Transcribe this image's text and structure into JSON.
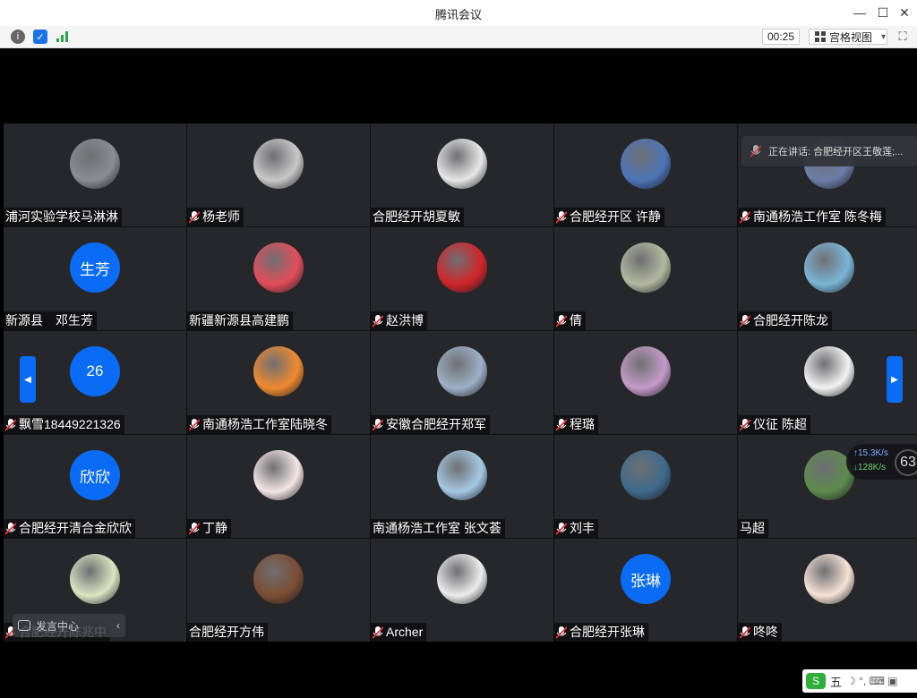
{
  "app": {
    "title": "腾讯会议"
  },
  "window_controls": {
    "minimize": "—",
    "maximize": "☐",
    "close": "✕"
  },
  "toolbar": {
    "timer": "00:25",
    "view_label": "宫格视图",
    "view_caret": "▾"
  },
  "speaking": {
    "text": "正在讲话: 合肥经开区王敬莲;..."
  },
  "network": {
    "up": "↑15.3K/s",
    "down": "↓128K/s",
    "partial": "63"
  },
  "chat_pill": {
    "label": "发言中心"
  },
  "ime": {
    "label": "五",
    "extra": "☽ °, ⌨ ▣"
  },
  "participants": [
    {
      "name": "浦河实验学校马淋淋",
      "muted": false,
      "avatar": "photo",
      "color": "#8a8c90",
      "initials": ""
    },
    {
      "name": "杨老师",
      "muted": true,
      "avatar": "photo",
      "color": "#c8c8c8",
      "initials": ""
    },
    {
      "name": "合肥经开胡夏敏",
      "muted": false,
      "avatar": "photo",
      "color": "#e7e7e7",
      "initials": ""
    },
    {
      "name": "合肥经开区 许静",
      "muted": true,
      "avatar": "photo",
      "color": "#4d74b8",
      "initials": ""
    },
    {
      "name": "南通杨浩工作室 陈冬梅",
      "muted": true,
      "avatar": "photo",
      "color": "#6c7da8",
      "initials": ""
    },
    {
      "name": "新源县　邓生芳",
      "muted": false,
      "avatar": "text",
      "color": "#0a6cf5",
      "initials": "生芳"
    },
    {
      "name": "新疆新源县高建鹏",
      "muted": false,
      "avatar": "photo",
      "color": "#e24d5a",
      "initials": ""
    },
    {
      "name": "赵洪博",
      "muted": true,
      "avatar": "photo",
      "color": "#d0252a",
      "initials": ""
    },
    {
      "name": "倩",
      "muted": true,
      "avatar": "photo",
      "color": "#b3b8a0",
      "initials": ""
    },
    {
      "name": "合肥经开陈龙",
      "muted": true,
      "avatar": "photo",
      "color": "#7ab6d6",
      "initials": ""
    },
    {
      "name": "飘雪18449221326",
      "muted": true,
      "avatar": "text",
      "color": "#0a6cf5",
      "initials": "26"
    },
    {
      "name": "南通杨浩工作室陆晓冬",
      "muted": true,
      "avatar": "photo",
      "color": "#f08a30",
      "initials": ""
    },
    {
      "name": "安徽合肥经开郑军",
      "muted": true,
      "avatar": "photo",
      "color": "#9db0c6",
      "initials": ""
    },
    {
      "name": "程璐",
      "muted": true,
      "avatar": "photo",
      "color": "#c49bc9",
      "initials": ""
    },
    {
      "name": "仪征 陈超",
      "muted": true,
      "avatar": "photo",
      "color": "#f2f2f2",
      "initials": ""
    },
    {
      "name": "合肥经开清合金欣欣",
      "muted": true,
      "avatar": "text",
      "color": "#0a6cf5",
      "initials": "欣欣"
    },
    {
      "name": "丁静",
      "muted": true,
      "avatar": "photo",
      "color": "#f3e4e6",
      "initials": ""
    },
    {
      "name": "南通杨浩工作室 张文荟",
      "muted": false,
      "avatar": "photo",
      "color": "#a5c8e4",
      "initials": ""
    },
    {
      "name": "刘丰",
      "muted": true,
      "avatar": "photo",
      "color": "#3e6a8c",
      "initials": ""
    },
    {
      "name": "马超",
      "muted": false,
      "avatar": "photo",
      "color": "#5d8a4d",
      "initials": ""
    },
    {
      "name": "合肥经开陈兆中",
      "muted": true,
      "avatar": "photo",
      "color": "#d9e5c2",
      "initials": ""
    },
    {
      "name": "合肥经开方伟",
      "muted": false,
      "avatar": "photo",
      "color": "#7b4d33",
      "initials": ""
    },
    {
      "name": "Archer",
      "muted": true,
      "avatar": "photo",
      "color": "#ececec",
      "initials": ""
    },
    {
      "name": "合肥经开张琳",
      "muted": true,
      "avatar": "text",
      "color": "#0a6cf5",
      "initials": "张琳"
    },
    {
      "name": "咚咚",
      "muted": true,
      "avatar": "photo",
      "color": "#f6e2d6",
      "initials": ""
    }
  ]
}
